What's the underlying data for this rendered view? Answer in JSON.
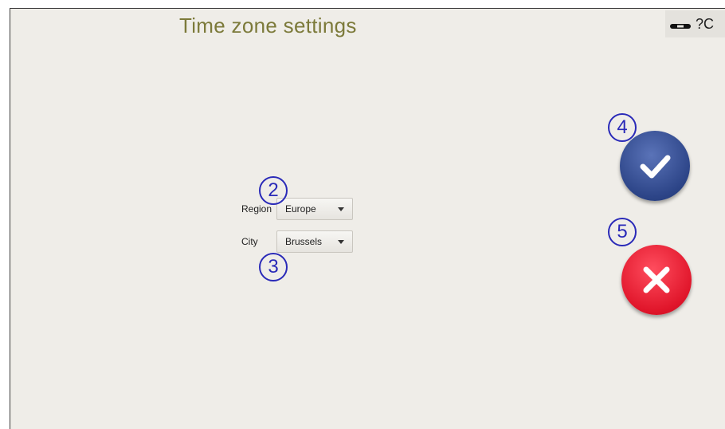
{
  "header": {
    "title": "Time zone settings",
    "help_text": "?C"
  },
  "form": {
    "region": {
      "label": "Region",
      "value": "Europe"
    },
    "city": {
      "label": "City",
      "value": "Brussels"
    }
  },
  "annotations": {
    "region_marker": "2",
    "city_marker": "3",
    "confirm_marker": "4",
    "cancel_marker": "5"
  },
  "colors": {
    "title": "#7c7a3a",
    "background": "#efede8",
    "confirm": "#2c4487",
    "cancel": "#e0152a",
    "marker": "#2a2ab8"
  },
  "icons": {
    "keyboard": "keyboard-icon",
    "confirm": "checkmark-icon",
    "cancel": "close-icon"
  }
}
